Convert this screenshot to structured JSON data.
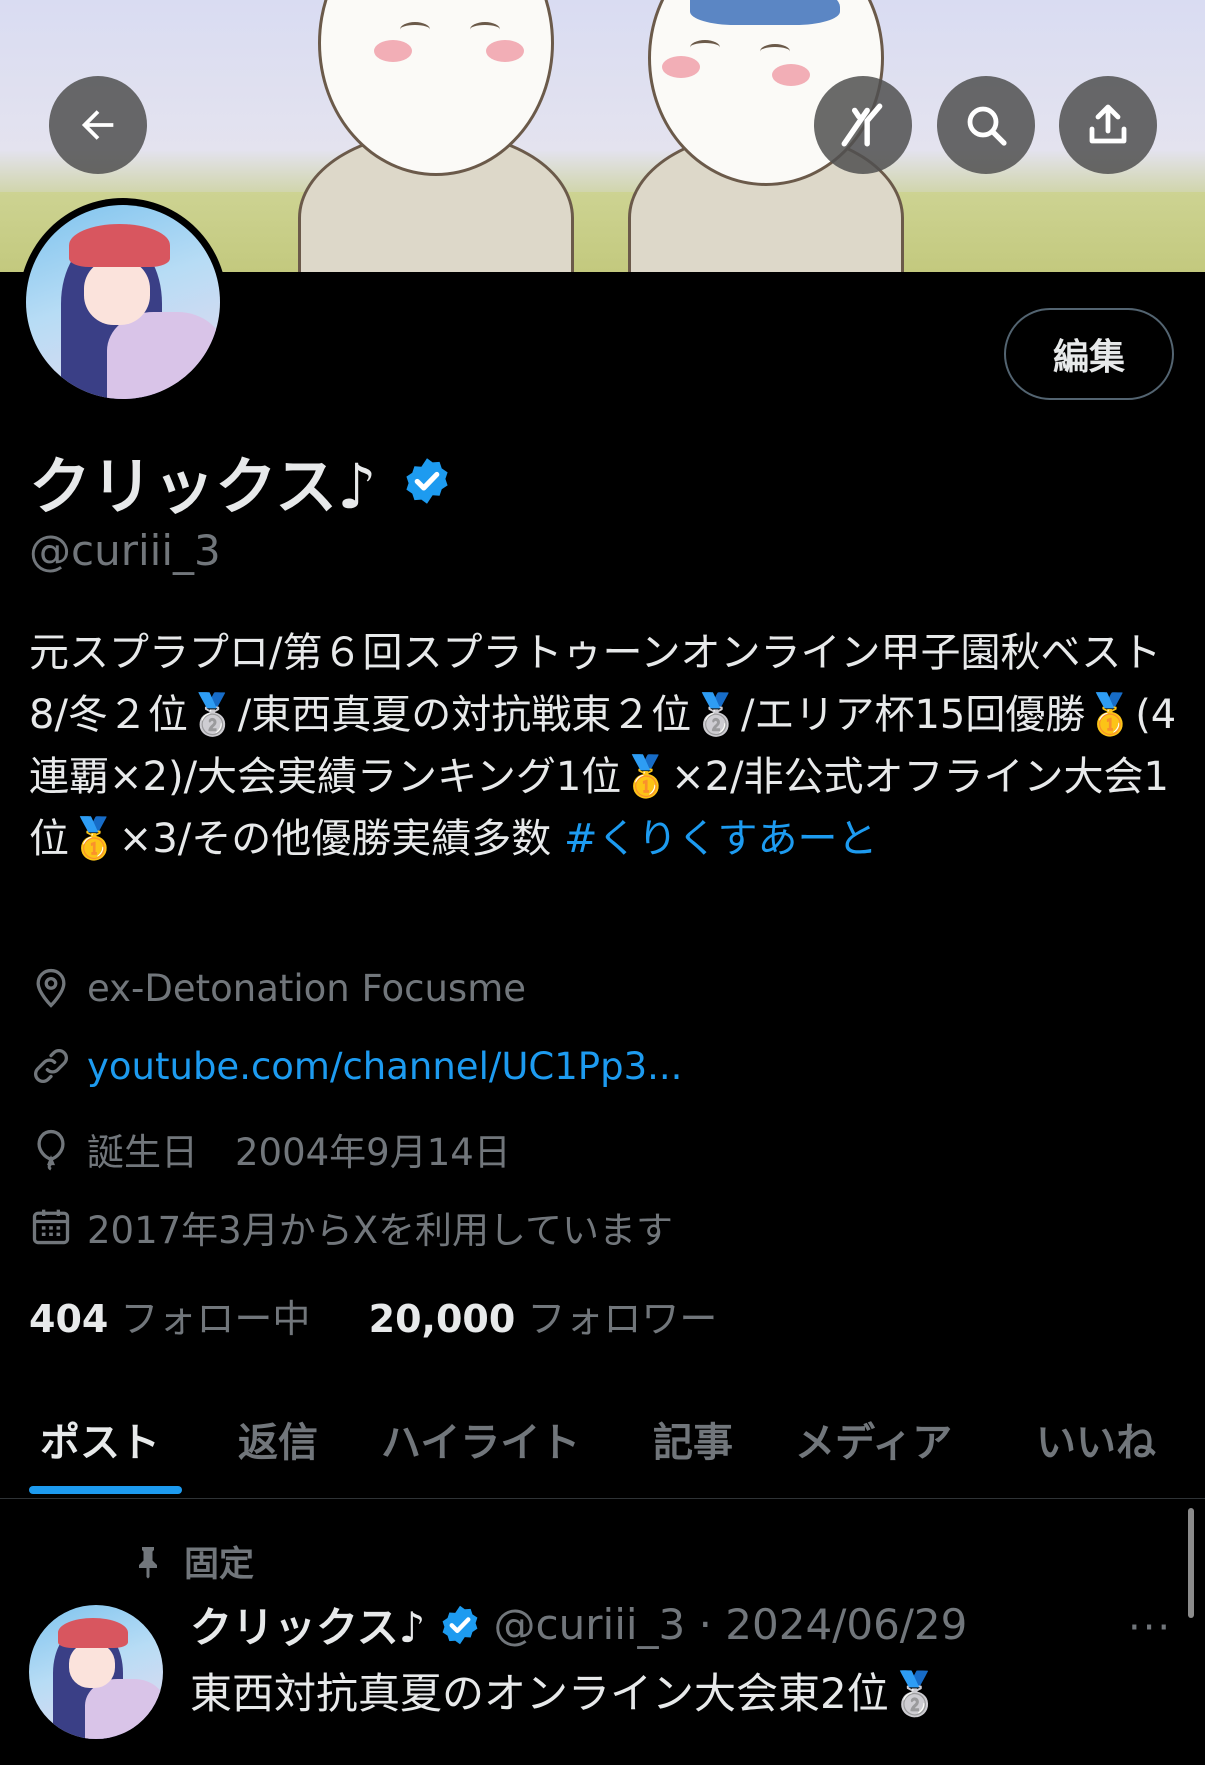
{
  "header": {
    "back_icon": "arrow-left-icon",
    "grok_icon": "grok-icon",
    "search_icon": "search-icon",
    "share_icon": "share-icon"
  },
  "profile": {
    "edit_label": "編集",
    "display_name": "クリックス♪",
    "handle": "@curiii_3",
    "bio": "元スプラプロ/第６回スプラトゥーンオンライン甲子園秋ベスト8/冬２位🥈/東西真夏の対抗戦東２位🥈/エリア杯15回優勝🥇(4連覇×2)/大会実績ランキング1位🥇×2/非公式オフライン大会1位🥇×3/その他優勝実績多数 ",
    "hashtag": "#くりくすあーと",
    "location": "ex-Detonation Focusme",
    "link": "youtube.com/channel/UC1Pp3...",
    "birthday": "誕生日　2004年9月14日",
    "joined": "2017年3月からXを利用しています",
    "following_count": "404",
    "following_label": "フォロー中",
    "followers_count": "20,000",
    "followers_label": "フォロワー"
  },
  "tabs": [
    "ポスト",
    "返信",
    "ハイライト",
    "記事",
    "メディア",
    "いいね"
  ],
  "pinned_post": {
    "pinned_label": "固定",
    "name": "クリックス♪",
    "handle_date": "@curiii_3 · 2024/06/29",
    "more": "···",
    "text": "東西対抗真夏のオンライン大会東2位🥈"
  },
  "colors": {
    "accent": "#1d9bf0",
    "background": "#000000",
    "secondary_text": "#71767b",
    "primary_text": "#e7e9ea"
  }
}
